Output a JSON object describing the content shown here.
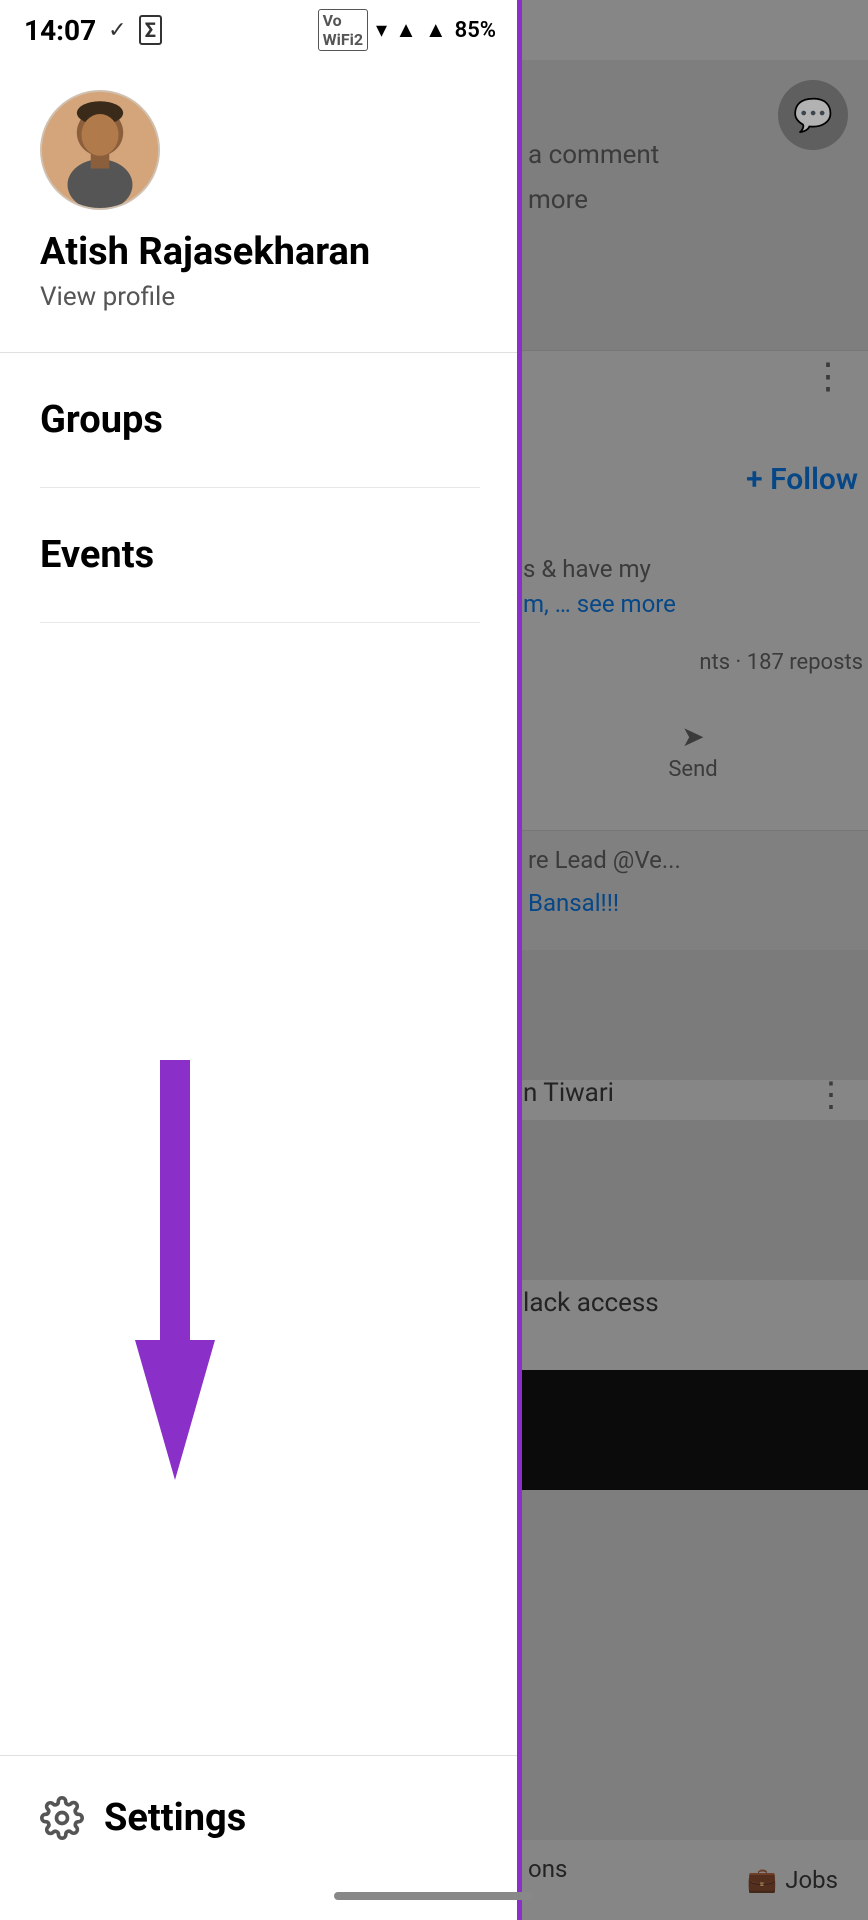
{
  "statusBar": {
    "time": "14:07",
    "batteryPercent": "85%",
    "icons": {
      "check": "✓",
      "sigma": "Σ",
      "wifi": "VoWiFi2"
    }
  },
  "drawer": {
    "user": {
      "name": "Atish Rajasekharan",
      "viewProfile": "View profile"
    },
    "menuItems": [
      {
        "label": "Groups"
      },
      {
        "label": "Events"
      }
    ],
    "footer": {
      "settingsLabel": "Settings"
    }
  },
  "rightPanel": {
    "followButton": "+ Follow",
    "sendLabel": "Send",
    "repostsText": "nts · 187 reposts",
    "text1": "s & have my",
    "text2": "m, … see more",
    "commentText1": "a comment",
    "commentText2": "more",
    "nameLabel": "re Lead @Ve...",
    "bansalText": "Bansal!!!",
    "tiwariText": "n Tiwari",
    "lackText": "lack access",
    "onsText": "ons",
    "jobsText": "Jobs"
  },
  "annotation": {
    "arrowColor": "#8B2FC9"
  }
}
